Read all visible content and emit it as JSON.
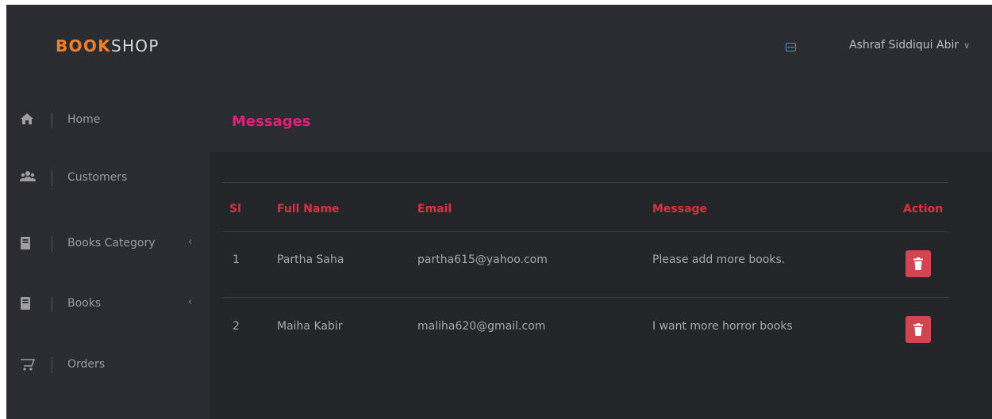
{
  "brand": {
    "part1": "BOOK",
    "part2": "SHOP"
  },
  "header": {
    "user_name": "Ashraf Siddiqui Abir",
    "user_chevron": "∨",
    "mail_icon": "mail-icon"
  },
  "sidebar": {
    "items": [
      {
        "label": "Home",
        "icon": "home-icon"
      },
      {
        "label": "Customers",
        "icon": "users-icon"
      },
      {
        "label": "Books Category",
        "icon": "book-icon",
        "arrow": "‹"
      },
      {
        "label": "Books",
        "icon": "book-icon",
        "arrow": "‹"
      },
      {
        "label": "Orders",
        "icon": "cart-icon"
      }
    ]
  },
  "main": {
    "title": "Messages",
    "table": {
      "headers": {
        "sl": "Sl",
        "name": "Full Name",
        "email": "Email",
        "message": "Message",
        "action": "Action"
      },
      "rows": [
        {
          "sl": "1",
          "name": "Partha Saha",
          "email": "partha615@yahoo.com",
          "message": "Please add more books."
        },
        {
          "sl": "2",
          "name": "Maiha Kabir",
          "email": "maliha620@gmail.com",
          "message": "I want more horror books"
        }
      ]
    }
  },
  "colors": {
    "brand_accent": "#f07f2a",
    "title": "#e41e7a",
    "table_header": "#e0303f",
    "delete_button": "#d0454f",
    "background": "#232529",
    "panel": "#2a2c31"
  }
}
